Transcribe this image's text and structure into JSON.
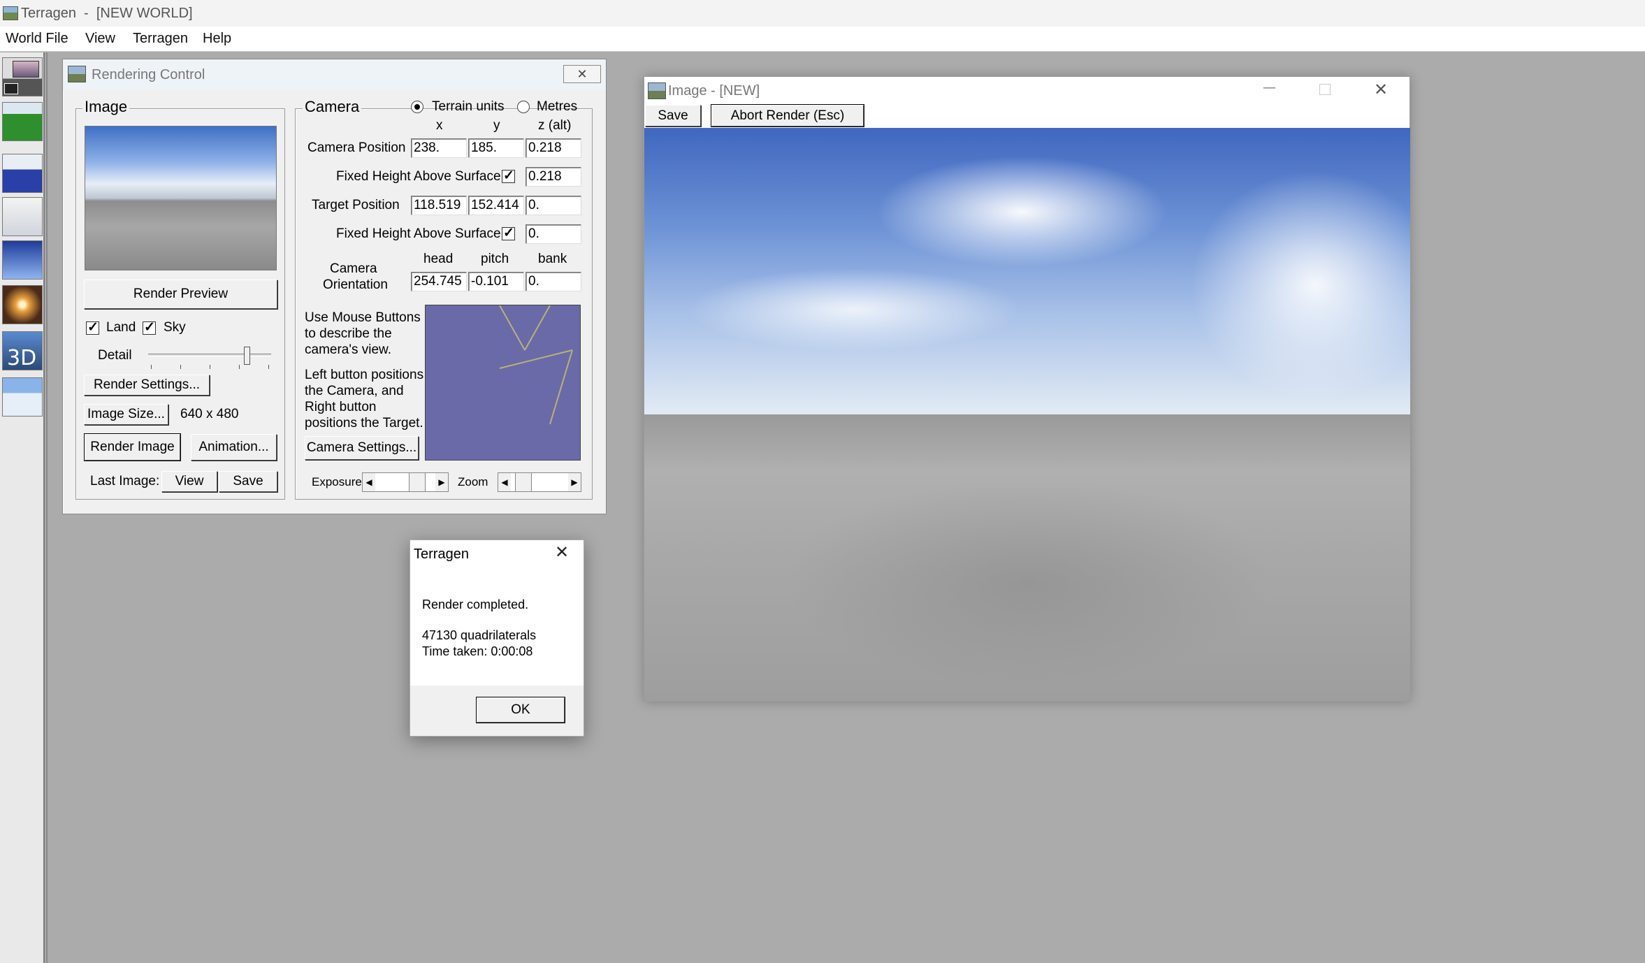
{
  "app": {
    "title": "Terragen  -  [NEW WORLD]",
    "menu": [
      "World File",
      "View",
      "Terragen",
      "Help"
    ]
  },
  "toolbar": {
    "tools": [
      "rendering-control-icon",
      "landscape-icon",
      "water-icon",
      "clouds-icon",
      "sky-icon",
      "lighting-icon",
      "3d-preview-icon",
      "atmosphere-icon"
    ],
    "tool_3d_label": "3D"
  },
  "rendering_control": {
    "title": "Rendering Control",
    "image_group": {
      "title": "Image",
      "render_preview": "Render Preview",
      "land_label": "Land",
      "land_checked": true,
      "sky_label": "Sky",
      "sky_checked": true,
      "detail_label": "Detail",
      "detail_level": 0.8,
      "render_settings": "Render Settings...",
      "image_size_button": "Image Size...",
      "image_size_value": "640 x 480",
      "render_image": "Render Image",
      "animation": "Animation...",
      "last_image_label": "Last Image:",
      "view": "View",
      "save": "Save"
    },
    "camera_group": {
      "title": "Camera",
      "terrain_units": "Terrain units",
      "metres": "Metres",
      "units_selected": "terrain",
      "col_x": "x",
      "col_y": "y",
      "col_z": "z (alt)",
      "camera_position_label": "Camera Position",
      "camera_position": [
        "238.",
        "185.",
        "0.218"
      ],
      "fixed_height_label": "Fixed Height Above Surface",
      "camera_fixed_height": true,
      "camera_fixed_height_value": "0.218",
      "target_position_label": "Target Position",
      "target_position": [
        "118.519",
        "152.414",
        "0."
      ],
      "target_fixed_height": true,
      "target_fixed_height_value": "0.",
      "col_head": "head",
      "col_pitch": "pitch",
      "col_bank": "bank",
      "orientation_label_1": "Camera",
      "orientation_label_2": "Orientation",
      "orientation": [
        "254.745",
        "-0.101",
        "0."
      ],
      "help_1": [
        "Use Mouse Buttons",
        "to describe the",
        "camera's view."
      ],
      "help_2": [
        "Left button positions",
        "the Camera, and",
        "Right button",
        "positions the Target."
      ],
      "camera_settings": "Camera Settings...",
      "exposure_label": "Exposure",
      "zoom_label": "Zoom"
    }
  },
  "dialog": {
    "title": "Terragen",
    "message": "Render completed.",
    "stats_1": "47130 quadrilaterals",
    "stats_2": "Time taken: 0:00:08",
    "ok": "OK"
  },
  "image_window": {
    "title": "Image - [NEW]",
    "save": "Save",
    "abort": "Abort Render (Esc)"
  },
  "colors": {
    "mdi_background": "#ababab",
    "map_background": "#6a6aa8",
    "map_lines": "#b9b07a"
  }
}
